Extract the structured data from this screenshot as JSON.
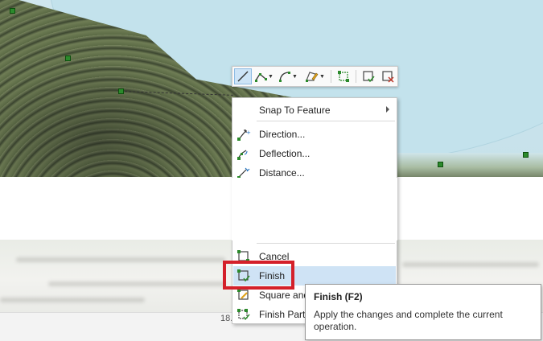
{
  "toolbar": {
    "buttons": [
      {
        "icon": "line-segment-icon",
        "active": true
      },
      {
        "icon": "polyline-icon",
        "dropdown": true
      },
      {
        "icon": "arc-icon",
        "dropdown": true
      },
      {
        "icon": "edit-vertices-icon",
        "dropdown": true
      },
      {
        "icon": "snap-grid-icon"
      },
      {
        "icon": "finish-sketch-icon"
      },
      {
        "icon": "delete-sketch-icon"
      }
    ]
  },
  "menu": {
    "snap_to_feature": "Snap To Feature",
    "direction": "Direction...",
    "deflection": "Deflection...",
    "distance": "Distance...",
    "cancel": "Cancel",
    "finish": "Finish",
    "square_and": "Square and",
    "finish_part": "Finish Part"
  },
  "ellipsis": "...",
  "status": {
    "scale_partial": "18."
  },
  "tooltip": {
    "title": "Finish (F2)",
    "description": "Apply the changes and complete the current operation."
  },
  "colors": {
    "highlight": "#cfe3f5",
    "annotation_red": "#d4202a",
    "vertex_green": "#2c8a2c"
  }
}
